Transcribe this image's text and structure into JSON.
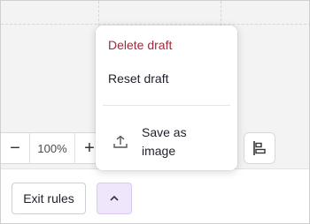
{
  "zoom": {
    "minus": "−",
    "value": "100%",
    "plus": "+"
  },
  "menu": {
    "delete_label": "Delete draft",
    "reset_label": "Reset draft",
    "save_label": "Save as image"
  },
  "bottom": {
    "exit_label": "Exit rules"
  },
  "icons": {
    "upload": "upload-icon",
    "align": "align-left-icon",
    "chevron": "chevron-up-icon"
  },
  "colors": {
    "delete_text": "#a32a3a",
    "toggle_bg": "#efe6fb",
    "canvas_bg": "#f3f3f3"
  }
}
